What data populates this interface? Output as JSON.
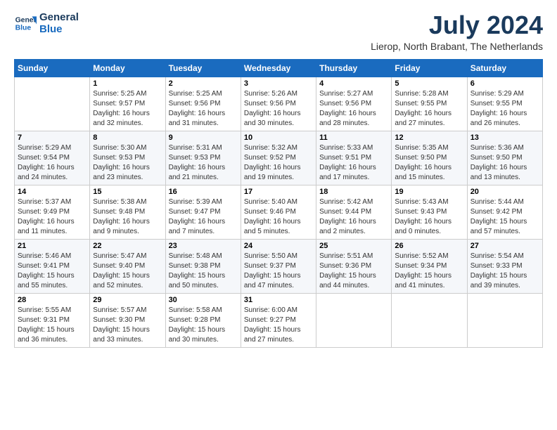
{
  "logo": {
    "line1": "General",
    "line2": "Blue"
  },
  "title": "July 2024",
  "location": "Lierop, North Brabant, The Netherlands",
  "days_of_week": [
    "Sunday",
    "Monday",
    "Tuesday",
    "Wednesday",
    "Thursday",
    "Friday",
    "Saturday"
  ],
  "weeks": [
    [
      {
        "day": "",
        "info": ""
      },
      {
        "day": "1",
        "info": "Sunrise: 5:25 AM\nSunset: 9:57 PM\nDaylight: 16 hours\nand 32 minutes."
      },
      {
        "day": "2",
        "info": "Sunrise: 5:25 AM\nSunset: 9:56 PM\nDaylight: 16 hours\nand 31 minutes."
      },
      {
        "day": "3",
        "info": "Sunrise: 5:26 AM\nSunset: 9:56 PM\nDaylight: 16 hours\nand 30 minutes."
      },
      {
        "day": "4",
        "info": "Sunrise: 5:27 AM\nSunset: 9:56 PM\nDaylight: 16 hours\nand 28 minutes."
      },
      {
        "day": "5",
        "info": "Sunrise: 5:28 AM\nSunset: 9:55 PM\nDaylight: 16 hours\nand 27 minutes."
      },
      {
        "day": "6",
        "info": "Sunrise: 5:29 AM\nSunset: 9:55 PM\nDaylight: 16 hours\nand 26 minutes."
      }
    ],
    [
      {
        "day": "7",
        "info": "Sunrise: 5:29 AM\nSunset: 9:54 PM\nDaylight: 16 hours\nand 24 minutes."
      },
      {
        "day": "8",
        "info": "Sunrise: 5:30 AM\nSunset: 9:53 PM\nDaylight: 16 hours\nand 23 minutes."
      },
      {
        "day": "9",
        "info": "Sunrise: 5:31 AM\nSunset: 9:53 PM\nDaylight: 16 hours\nand 21 minutes."
      },
      {
        "day": "10",
        "info": "Sunrise: 5:32 AM\nSunset: 9:52 PM\nDaylight: 16 hours\nand 19 minutes."
      },
      {
        "day": "11",
        "info": "Sunrise: 5:33 AM\nSunset: 9:51 PM\nDaylight: 16 hours\nand 17 minutes."
      },
      {
        "day": "12",
        "info": "Sunrise: 5:35 AM\nSunset: 9:50 PM\nDaylight: 16 hours\nand 15 minutes."
      },
      {
        "day": "13",
        "info": "Sunrise: 5:36 AM\nSunset: 9:50 PM\nDaylight: 16 hours\nand 13 minutes."
      }
    ],
    [
      {
        "day": "14",
        "info": "Sunrise: 5:37 AM\nSunset: 9:49 PM\nDaylight: 16 hours\nand 11 minutes."
      },
      {
        "day": "15",
        "info": "Sunrise: 5:38 AM\nSunset: 9:48 PM\nDaylight: 16 hours\nand 9 minutes."
      },
      {
        "day": "16",
        "info": "Sunrise: 5:39 AM\nSunset: 9:47 PM\nDaylight: 16 hours\nand 7 minutes."
      },
      {
        "day": "17",
        "info": "Sunrise: 5:40 AM\nSunset: 9:46 PM\nDaylight: 16 hours\nand 5 minutes."
      },
      {
        "day": "18",
        "info": "Sunrise: 5:42 AM\nSunset: 9:44 PM\nDaylight: 16 hours\nand 2 minutes."
      },
      {
        "day": "19",
        "info": "Sunrise: 5:43 AM\nSunset: 9:43 PM\nDaylight: 16 hours\nand 0 minutes."
      },
      {
        "day": "20",
        "info": "Sunrise: 5:44 AM\nSunset: 9:42 PM\nDaylight: 15 hours\nand 57 minutes."
      }
    ],
    [
      {
        "day": "21",
        "info": "Sunrise: 5:46 AM\nSunset: 9:41 PM\nDaylight: 15 hours\nand 55 minutes."
      },
      {
        "day": "22",
        "info": "Sunrise: 5:47 AM\nSunset: 9:40 PM\nDaylight: 15 hours\nand 52 minutes."
      },
      {
        "day": "23",
        "info": "Sunrise: 5:48 AM\nSunset: 9:38 PM\nDaylight: 15 hours\nand 50 minutes."
      },
      {
        "day": "24",
        "info": "Sunrise: 5:50 AM\nSunset: 9:37 PM\nDaylight: 15 hours\nand 47 minutes."
      },
      {
        "day": "25",
        "info": "Sunrise: 5:51 AM\nSunset: 9:36 PM\nDaylight: 15 hours\nand 44 minutes."
      },
      {
        "day": "26",
        "info": "Sunrise: 5:52 AM\nSunset: 9:34 PM\nDaylight: 15 hours\nand 41 minutes."
      },
      {
        "day": "27",
        "info": "Sunrise: 5:54 AM\nSunset: 9:33 PM\nDaylight: 15 hours\nand 39 minutes."
      }
    ],
    [
      {
        "day": "28",
        "info": "Sunrise: 5:55 AM\nSunset: 9:31 PM\nDaylight: 15 hours\nand 36 minutes."
      },
      {
        "day": "29",
        "info": "Sunrise: 5:57 AM\nSunset: 9:30 PM\nDaylight: 15 hours\nand 33 minutes."
      },
      {
        "day": "30",
        "info": "Sunrise: 5:58 AM\nSunset: 9:28 PM\nDaylight: 15 hours\nand 30 minutes."
      },
      {
        "day": "31",
        "info": "Sunrise: 6:00 AM\nSunset: 9:27 PM\nDaylight: 15 hours\nand 27 minutes."
      },
      {
        "day": "",
        "info": ""
      },
      {
        "day": "",
        "info": ""
      },
      {
        "day": "",
        "info": ""
      }
    ]
  ]
}
